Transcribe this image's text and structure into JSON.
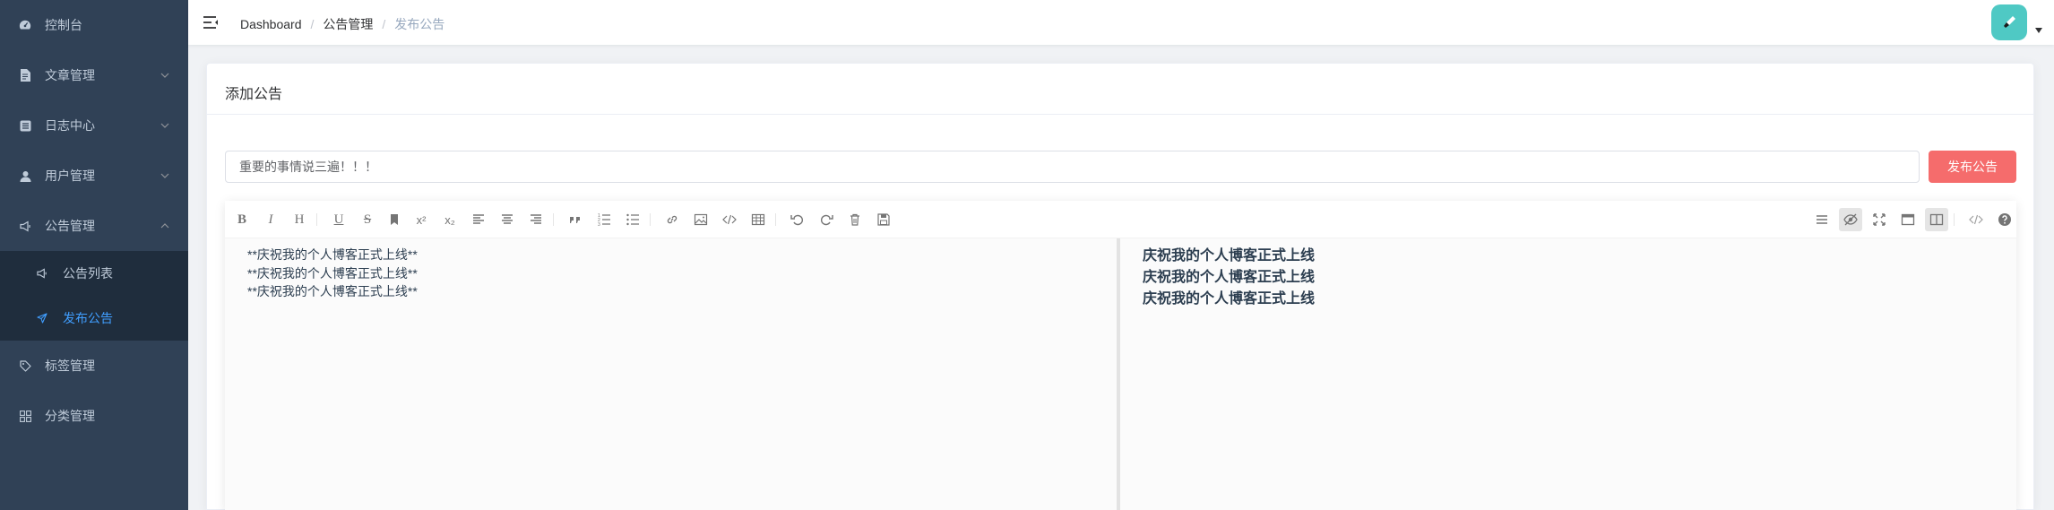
{
  "sidebar": {
    "items": [
      {
        "label": "控制台",
        "icon": "dashboard-icon",
        "has_arrow": false
      },
      {
        "label": "文章管理",
        "icon": "document-icon",
        "has_arrow": true,
        "arrow": "down"
      },
      {
        "label": "日志中心",
        "icon": "log-icon",
        "has_arrow": true,
        "arrow": "down"
      },
      {
        "label": "用户管理",
        "icon": "user-icon",
        "has_arrow": true,
        "arrow": "down"
      },
      {
        "label": "公告管理",
        "icon": "megaphone-icon",
        "has_arrow": true,
        "arrow": "up",
        "expanded": true
      },
      {
        "label": "标签管理",
        "icon": "tag-icon",
        "has_arrow": false
      },
      {
        "label": "分类管理",
        "icon": "grid-icon",
        "has_arrow": false
      }
    ],
    "subitems": [
      {
        "label": "公告列表",
        "icon": "megaphone-icon",
        "active": false
      },
      {
        "label": "发布公告",
        "icon": "send-icon",
        "active": true
      }
    ],
    "colors": {
      "bg": "#304156",
      "submenu_bg": "#1f2d3d",
      "text": "#bfcbd9",
      "active": "#409eff"
    }
  },
  "navbar": {
    "breadcrumb": [
      "Dashboard",
      "公告管理",
      "发布公告"
    ],
    "separator": "/",
    "avatar_color": "#4fc9c4"
  },
  "card": {
    "title": "添加公告"
  },
  "form": {
    "title_value": "重要的事情说三遍！！！",
    "publish_label": "发布公告",
    "publish_color": "#f56c6c"
  },
  "editor": {
    "toolbar_left": [
      "bold-icon",
      "italic-icon",
      "header-icon",
      "underline-icon",
      "strikethrough-icon",
      "mark-icon",
      "superscript-icon",
      "subscript-icon",
      "align-left-icon",
      "align-center-icon",
      "align-right-icon",
      "quote-icon",
      "ordered-list-icon",
      "unordered-list-icon",
      "link-icon",
      "image-icon",
      "code-icon",
      "table-icon",
      "undo-icon",
      "redo-icon",
      "trash-icon",
      "save-icon"
    ],
    "toolbar_right": [
      "navigation-icon",
      "preview-toggle-icon",
      "fullscreen-icon",
      "read-mode-icon",
      "subfield-icon",
      "html-code-icon",
      "help-icon"
    ],
    "source_lines": [
      "**庆祝我的个人博客正式上线**",
      "**庆祝我的个人博客正式上线**",
      "**庆祝我的个人博客正式上线**"
    ],
    "preview_lines": [
      "庆祝我的个人博客正式上线",
      "庆祝我的个人博客正式上线",
      "庆祝我的个人博客正式上线"
    ]
  }
}
